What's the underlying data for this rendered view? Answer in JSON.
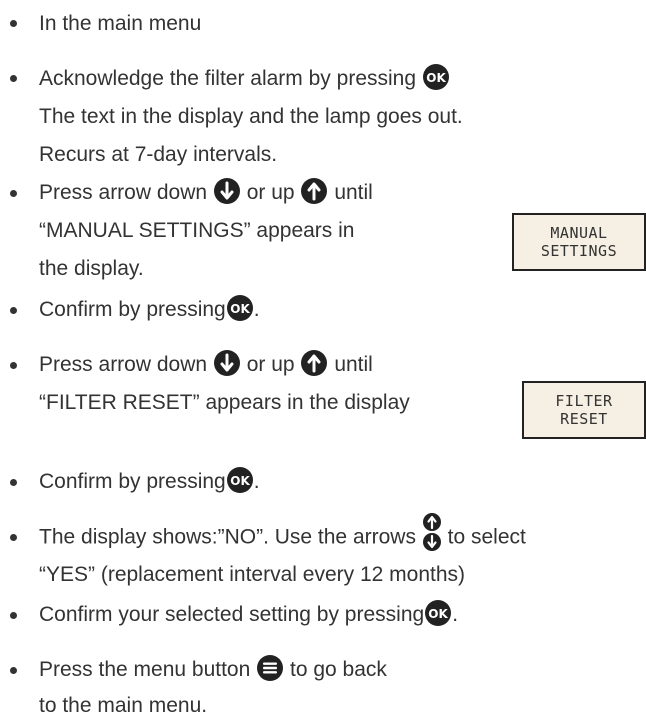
{
  "steps": [
    {
      "lines": [
        "In the main menu"
      ]
    },
    {
      "lines": [
        "Acknowledge the filter alarm by pressing",
        "The text in the display and the lamp goes out.",
        "Recurs at 7-day intervals."
      ]
    },
    {
      "lines": [
        "Press arrow down",
        "or up",
        "until",
        "“MANUAL SETTINGS” appears in",
        "the display."
      ]
    },
    {
      "lines": [
        "Confirm by pressing",
        "."
      ]
    },
    {
      "lines": [
        "Press arrow down",
        "or up",
        "until",
        "“FILTER RESET” appears in the display"
      ]
    },
    {
      "lines": [
        "Confirm by pressing",
        "."
      ]
    },
    {
      "lines": [
        "The display shows:”NO”. Use the arrows",
        "to select",
        "“YES” (replacement interval every 12 months)"
      ]
    },
    {
      "lines": [
        "Confirm your selected setting by pressing",
        "."
      ]
    },
    {
      "lines": [
        "Press the menu button",
        "to go back",
        "to the main menu."
      ]
    }
  ],
  "buttons": {
    "ok_label": "OK"
  },
  "displays": {
    "manual_settings": [
      "MANUAL",
      "SETTINGS"
    ],
    "filter_reset": [
      "FILTER",
      "RESET"
    ]
  },
  "icons": {
    "ok": "ok-button-icon",
    "arrow_down": "arrow-down-button-icon",
    "arrow_up": "arrow-up-button-icon",
    "arrows_pair": "arrows-up-down-icon",
    "menu": "menu-button-icon"
  },
  "colors": {
    "text": "#333333",
    "icon": "#222222",
    "display_bg": "#f6efe3",
    "display_border": "#222222"
  }
}
